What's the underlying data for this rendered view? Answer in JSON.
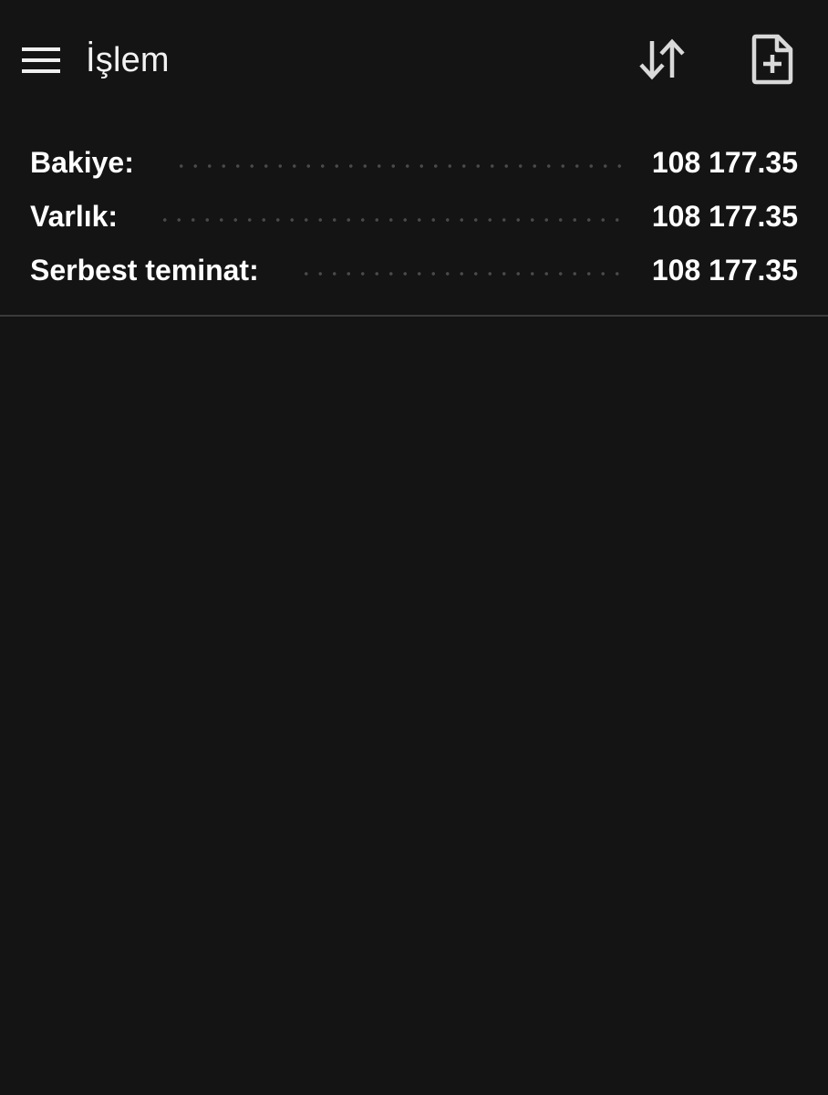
{
  "app_bar": {
    "title": "İşlem",
    "menu_icon": "hamburger-menu-icon",
    "sort_icon": "sort-arrows-icon",
    "new_document_icon": "new-document-icon"
  },
  "summary": {
    "rows": [
      {
        "label": "Bakiye:",
        "value": "108 177.35"
      },
      {
        "label": "Varlık:",
        "value": "108 177.35"
      },
      {
        "label": "Serbest teminat:",
        "value": "108 177.35"
      }
    ]
  },
  "colors": {
    "background": "#141414",
    "text": "#ffffff",
    "icon": "#d9d9d9",
    "divider": "#3a3a3a",
    "leader_dots": "#4a4a4a"
  }
}
